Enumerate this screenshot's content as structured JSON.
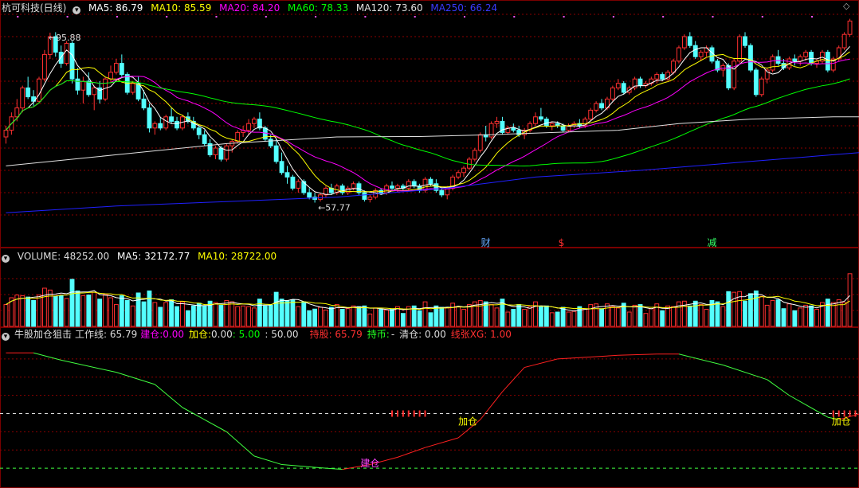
{
  "colors": {
    "up": "#ff3030",
    "down": "#54ffff",
    "ma5": "#ffffff",
    "ma10": "#ffff00",
    "ma20": "#ff00ff",
    "ma60": "#00ff00",
    "ma120": "#e0e0e0",
    "ma250": "#2020ff",
    "grid": "#8b0000",
    "work_up": "#ff2020",
    "work_down": "#40ff40"
  },
  "price_panel": {
    "title": "杭可科技(日线)",
    "icon": "chevron-down-icon",
    "ma5": "MA5: 86.79",
    "ma10": "MA10: 85.59",
    "ma20": "MA20: 84.20",
    "ma60": "MA60: 78.33",
    "ma120": "MA120: 73.60",
    "ma250": "MA250: 66.24",
    "high_label": "95.88",
    "low_label": "57.77",
    "marks": [
      {
        "text": "财",
        "color": "#66aaff"
      },
      {
        "text": "$",
        "color": "#ff3030"
      },
      {
        "text": "减",
        "color": "#33ff66"
      }
    ],
    "corner_icon": "diamond-icon"
  },
  "volume_panel": {
    "title": "VOLUME: 48252.00",
    "ma5": "MA5: 32172.77",
    "ma10": "MA10: 28722.00"
  },
  "indicator_panel": {
    "name": "牛股加仓狙击",
    "work": "工作线: 65.79",
    "build_label": "建仓:",
    "build_val": "0.00",
    "add_label": "加仓:",
    "add_val": "0.00",
    "v5": ": 5.00",
    "v50": ": 50.00",
    "hold_label": "持股: 65.79",
    "hold_cash_label": "持币:",
    "hold_cash_val": "-",
    "clear": "清仓: 0.00",
    "xg": "线张XG: 1.00",
    "signal_build": "建仓",
    "signal_add": "加仓"
  },
  "chart_data": {
    "type": "candlestick",
    "ylim": [
      50,
      100
    ],
    "ohlc": [
      [
        72.5,
        75.0,
        71.0,
        74.0
      ],
      [
        74.0,
        78.0,
        73.0,
        77.0
      ],
      [
        77.0,
        81.0,
        76.0,
        79.0
      ],
      [
        79.0,
        84.0,
        78.0,
        83.5
      ],
      [
        83.5,
        86.0,
        81.0,
        81.5
      ],
      [
        81.5,
        83.0,
        79.5,
        80.5
      ],
      [
        80.5,
        86.0,
        80.0,
        85.5
      ],
      [
        85.5,
        92.0,
        85.0,
        91.0
      ],
      [
        91.0,
        95.88,
        90.0,
        95.0
      ],
      [
        95.0,
        96.0,
        90.5,
        91.5
      ],
      [
        91.5,
        93.0,
        88.0,
        89.0
      ],
      [
        89.0,
        94.0,
        88.5,
        93.5
      ],
      [
        93.5,
        94.0,
        84.5,
        85.5
      ],
      [
        85.5,
        88.0,
        82.0,
        83.0
      ],
      [
        83.0,
        86.0,
        80.0,
        85.0
      ],
      [
        85.0,
        87.0,
        81.5,
        82.0
      ],
      [
        82.0,
        84.0,
        78.5,
        83.5
      ],
      [
        83.5,
        85.0,
        80.0,
        81.0
      ],
      [
        81.0,
        86.0,
        80.5,
        85.5
      ],
      [
        85.5,
        88.5,
        84.5,
        87.0
      ],
      [
        87.0,
        90.0,
        86.5,
        89.0
      ],
      [
        89.0,
        91.0,
        86.0,
        86.5
      ],
      [
        86.5,
        87.0,
        82.0,
        82.5
      ],
      [
        82.5,
        85.0,
        82.0,
        84.5
      ],
      [
        84.5,
        86.0,
        80.5,
        81.0
      ],
      [
        81.0,
        83.0,
        78.5,
        79.0
      ],
      [
        79.0,
        80.0,
        73.5,
        74.5
      ],
      [
        74.5,
        76.0,
        73.0,
        75.5
      ],
      [
        75.5,
        77.0,
        74.0,
        74.5
      ],
      [
        74.5,
        77.5,
        74.0,
        77.0
      ],
      [
        77.0,
        79.0,
        75.5,
        76.0
      ],
      [
        76.0,
        77.0,
        74.0,
        74.5
      ],
      [
        74.5,
        77.5,
        74.0,
        77.0
      ],
      [
        77.0,
        78.0,
        75.5,
        76.0
      ],
      [
        76.0,
        77.0,
        74.0,
        74.5
      ],
      [
        74.5,
        75.0,
        72.0,
        73.0
      ],
      [
        73.0,
        74.0,
        70.5,
        71.0
      ],
      [
        71.0,
        72.0,
        68.0,
        68.5
      ],
      [
        68.5,
        70.5,
        67.5,
        70.0
      ],
      [
        70.0,
        70.5,
        67.0,
        67.5
      ],
      [
        67.5,
        71.0,
        67.0,
        70.5
      ],
      [
        70.5,
        72.0,
        69.0,
        71.5
      ],
      [
        71.5,
        74.0,
        71.0,
        73.5
      ],
      [
        73.5,
        75.0,
        72.5,
        74.0
      ],
      [
        74.0,
        76.5,
        73.0,
        75.5
      ],
      [
        75.5,
        77.0,
        74.5,
        76.5
      ],
      [
        76.5,
        78.0,
        74.0,
        74.5
      ],
      [
        74.5,
        75.0,
        71.5,
        72.0
      ],
      [
        72.0,
        73.0,
        70.0,
        70.5
      ],
      [
        70.5,
        72.0,
        66.5,
        67.0
      ],
      [
        67.0,
        69.0,
        64.0,
        64.5
      ],
      [
        64.5,
        66.0,
        62.0,
        63.5
      ],
      [
        63.5,
        64.0,
        60.5,
        61.0
      ],
      [
        61.0,
        63.0,
        60.0,
        62.5
      ],
      [
        62.5,
        63.0,
        59.5,
        60.0
      ],
      [
        60.0,
        61.0,
        58.5,
        59.0
      ],
      [
        59.0,
        60.0,
        57.77,
        58.5
      ],
      [
        58.5,
        60.0,
        58.0,
        59.5
      ],
      [
        59.5,
        61.5,
        59.0,
        61.0
      ],
      [
        61.0,
        62.0,
        59.5,
        60.0
      ],
      [
        60.0,
        62.0,
        59.5,
        61.5
      ],
      [
        61.5,
        62.0,
        59.5,
        60.0
      ],
      [
        60.0,
        61.5,
        59.5,
        61.0
      ],
      [
        61.0,
        62.5,
        60.5,
        62.0
      ],
      [
        62.0,
        62.5,
        59.5,
        60.0
      ],
      [
        60.0,
        60.5,
        58.0,
        58.5
      ],
      [
        58.5,
        59.5,
        57.8,
        59.0
      ],
      [
        59.0,
        61.0,
        58.5,
        60.5
      ],
      [
        60.5,
        61.0,
        59.5,
        60.0
      ],
      [
        60.0,
        62.0,
        59.5,
        61.5
      ],
      [
        61.5,
        62.5,
        60.5,
        61.0
      ],
      [
        61.0,
        62.0,
        60.0,
        61.5
      ],
      [
        61.5,
        62.0,
        60.5,
        61.0
      ],
      [
        61.0,
        63.0,
        60.5,
        62.5
      ],
      [
        62.5,
        63.0,
        61.0,
        61.5
      ],
      [
        61.5,
        62.0,
        60.0,
        60.5
      ],
      [
        60.5,
        63.5,
        60.0,
        63.0
      ],
      [
        63.0,
        63.5,
        61.5,
        62.0
      ],
      [
        62.0,
        63.0,
        60.0,
        60.5
      ],
      [
        60.5,
        61.0,
        59.0,
        59.5
      ],
      [
        59.5,
        61.5,
        58.5,
        61.0
      ],
      [
        61.0,
        64.0,
        60.5,
        63.5
      ],
      [
        63.5,
        65.0,
        63.0,
        64.5
      ],
      [
        64.5,
        66.0,
        63.5,
        65.5
      ],
      [
        65.5,
        68.0,
        65.0,
        67.5
      ],
      [
        67.5,
        70.0,
        67.0,
        69.5
      ],
      [
        69.5,
        73.5,
        69.0,
        73.0
      ],
      [
        73.0,
        75.0,
        71.5,
        72.5
      ],
      [
        72.5,
        76.0,
        72.0,
        75.5
      ],
      [
        75.5,
        77.0,
        74.5,
        76.0
      ],
      [
        76.0,
        77.0,
        73.0,
        73.5
      ],
      [
        73.5,
        75.0,
        73.0,
        74.5
      ],
      [
        74.5,
        75.5,
        73.5,
        74.0
      ],
      [
        74.0,
        75.0,
        72.5,
        73.0
      ],
      [
        73.0,
        74.5,
        72.0,
        74.0
      ],
      [
        74.0,
        76.0,
        73.5,
        75.5
      ],
      [
        75.5,
        78.0,
        75.0,
        77.0
      ],
      [
        77.0,
        79.0,
        76.0,
        76.5
      ],
      [
        76.5,
        77.0,
        74.5,
        75.0
      ],
      [
        75.0,
        76.0,
        74.0,
        75.5
      ],
      [
        75.5,
        76.0,
        74.5,
        75.0
      ],
      [
        75.0,
        75.5,
        73.5,
        74.0
      ],
      [
        74.0,
        75.5,
        73.5,
        75.0
      ],
      [
        75.0,
        76.0,
        74.5,
        75.5
      ],
      [
        75.5,
        76.5,
        74.5,
        75.0
      ],
      [
        75.0,
        77.0,
        74.5,
        76.5
      ],
      [
        76.5,
        79.0,
        76.0,
        78.5
      ],
      [
        78.5,
        80.5,
        78.0,
        80.0
      ],
      [
        80.0,
        81.0,
        78.5,
        79.0
      ],
      [
        79.0,
        81.5,
        78.5,
        81.0
      ],
      [
        81.0,
        84.0,
        80.5,
        83.5
      ],
      [
        83.5,
        85.5,
        83.0,
        84.5
      ],
      [
        84.5,
        85.0,
        82.0,
        82.5
      ],
      [
        82.5,
        84.0,
        82.0,
        83.5
      ],
      [
        83.5,
        86.0,
        83.0,
        85.5
      ],
      [
        85.5,
        86.0,
        83.5,
        84.0
      ],
      [
        84.0,
        85.0,
        83.5,
        84.5
      ],
      [
        84.5,
        86.0,
        84.0,
        85.5
      ],
      [
        85.5,
        87.0,
        84.5,
        86.5
      ],
      [
        86.5,
        87.0,
        85.0,
        85.5
      ],
      [
        85.5,
        87.5,
        85.0,
        87.0
      ],
      [
        87.0,
        90.0,
        86.5,
        89.5
      ],
      [
        89.5,
        93.0,
        89.0,
        92.5
      ],
      [
        92.5,
        95.5,
        92.0,
        95.0
      ],
      [
        95.0,
        96.0,
        92.5,
        93.0
      ],
      [
        93.0,
        94.0,
        90.0,
        90.5
      ],
      [
        90.5,
        92.0,
        89.5,
        91.5
      ],
      [
        91.5,
        93.0,
        90.5,
        92.5
      ],
      [
        92.5,
        93.0,
        89.0,
        89.5
      ],
      [
        89.5,
        90.0,
        87.0,
        87.5
      ],
      [
        87.5,
        89.0,
        86.0,
        88.5
      ],
      [
        88.5,
        89.0,
        83.0,
        83.5
      ],
      [
        83.5,
        90.0,
        83.0,
        89.5
      ],
      [
        89.5,
        95.5,
        89.0,
        95.0
      ],
      [
        95.0,
        96.0,
        92.5,
        93.0
      ],
      [
        93.0,
        93.5,
        87.0,
        87.5
      ],
      [
        87.5,
        88.0,
        81.5,
        82.0
      ],
      [
        82.0,
        86.0,
        81.5,
        85.5
      ],
      [
        85.5,
        88.0,
        84.5,
        87.5
      ],
      [
        87.5,
        91.0,
        87.0,
        90.5
      ],
      [
        90.5,
        92.0,
        88.5,
        89.0
      ],
      [
        89.0,
        90.0,
        87.5,
        88.0
      ],
      [
        88.0,
        90.5,
        87.5,
        90.0
      ],
      [
        90.0,
        91.0,
        88.5,
        89.5
      ],
      [
        89.5,
        91.0,
        88.5,
        90.5
      ],
      [
        90.5,
        92.0,
        89.5,
        91.5
      ],
      [
        91.5,
        92.0,
        88.5,
        89.0
      ],
      [
        89.0,
        90.0,
        88.0,
        89.5
      ],
      [
        89.5,
        92.0,
        89.0,
        91.5
      ],
      [
        91.5,
        92.0,
        87.0,
        87.5
      ],
      [
        87.5,
        90.5,
        87.0,
        90.0
      ],
      [
        90.0,
        93.0,
        89.5,
        92.5
      ],
      [
        92.5,
        96.0,
        92.0,
        95.5
      ],
      [
        95.5,
        99.0,
        95.0,
        98.5
      ]
    ],
    "ma120": [
      [
        0,
        66.0
      ],
      [
        20,
        68.5
      ],
      [
        40,
        71.0
      ],
      [
        60,
        72.5
      ],
      [
        75,
        72.6
      ],
      [
        88,
        73.0
      ],
      [
        111,
        74.0
      ],
      [
        122,
        75.5
      ],
      [
        135,
        76.5
      ],
      [
        150,
        77.0
      ],
      [
        155,
        77.0
      ]
    ],
    "ma250": [
      [
        0,
        55.5
      ],
      [
        20,
        57.0
      ],
      [
        40,
        58.0
      ],
      [
        60,
        59.0
      ],
      [
        80,
        61.0
      ],
      [
        96,
        63.5
      ],
      [
        115,
        65.0
      ],
      [
        135,
        67.0
      ],
      [
        155,
        69.0
      ]
    ],
    "volume": {
      "title": "VOLUME",
      "ylim": [
        0,
        140000
      ],
      "last": 48252
    },
    "indicator": {
      "ylim": [
        -10,
        110
      ],
      "work_line": [
        [
          0,
          100
        ],
        [
          5,
          100
        ],
        [
          10,
          94
        ],
        [
          20,
          84
        ],
        [
          27,
          74
        ],
        [
          32,
          55
        ],
        [
          40,
          35
        ],
        [
          45,
          15
        ],
        [
          50,
          8
        ],
        [
          58,
          5
        ],
        [
          61,
          4
        ],
        [
          66,
          8
        ],
        [
          71,
          14
        ],
        [
          76,
          22
        ],
        [
          82,
          30
        ],
        [
          86,
          45
        ],
        [
          90,
          68
        ],
        [
          94,
          88
        ],
        [
          100,
          95
        ],
        [
          111,
          98
        ],
        [
          118,
          99
        ],
        [
          122,
          99
        ],
        [
          130,
          90
        ],
        [
          138,
          78
        ],
        [
          142,
          65
        ],
        [
          149,
          47
        ],
        [
          151,
          45
        ],
        [
          155,
          50
        ]
      ],
      "ref_lines": [
        {
          "value": 50,
          "label": "50.00"
        },
        {
          "value": 5,
          "label": "5.00"
        }
      ]
    }
  }
}
